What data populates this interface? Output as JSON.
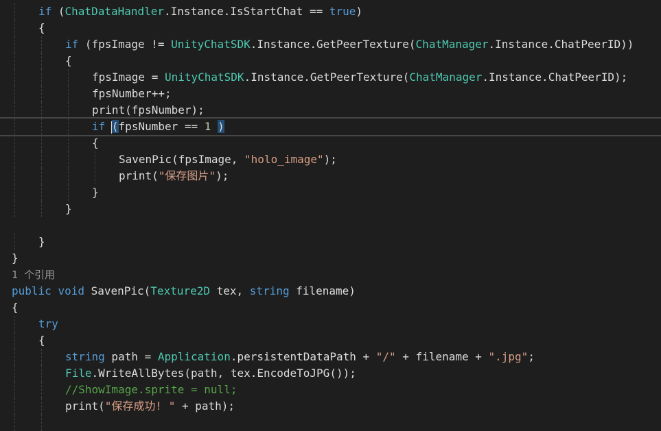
{
  "colors": {
    "background": "#1e1e1e",
    "keyword": "#569cd6",
    "type": "#4ec9b0",
    "string": "#d69d85",
    "comment": "#57a64a",
    "number": "#b5cea8",
    "plain": "#dcdcdc",
    "codelens": "#999999"
  },
  "editor": {
    "codelens": "1 个引用",
    "lines": [
      {
        "indent": 1,
        "tokens": [
          [
            "kw",
            "if"
          ],
          [
            "pl",
            " ("
          ],
          [
            "ty",
            "ChatDataHandler"
          ],
          [
            "pl",
            ".Instance.IsStartChat == "
          ],
          [
            "kw",
            "true"
          ],
          [
            "pl",
            ")"
          ]
        ]
      },
      {
        "indent": 1,
        "tokens": [
          [
            "pl",
            "{"
          ]
        ]
      },
      {
        "indent": 2,
        "tokens": [
          [
            "kw",
            "if"
          ],
          [
            "pl",
            " (fpsImage != "
          ],
          [
            "ty",
            "UnityChatSDK"
          ],
          [
            "pl",
            ".Instance.GetPeerTexture("
          ],
          [
            "ty",
            "ChatManager"
          ],
          [
            "pl",
            ".Instance.ChatPeerID))"
          ]
        ]
      },
      {
        "indent": 2,
        "tokens": [
          [
            "pl",
            "{"
          ]
        ]
      },
      {
        "indent": 3,
        "tokens": [
          [
            "pl",
            "fpsImage = "
          ],
          [
            "ty",
            "UnityChatSDK"
          ],
          [
            "pl",
            ".Instance.GetPeerTexture("
          ],
          [
            "ty",
            "ChatManager"
          ],
          [
            "pl",
            ".Instance.ChatPeerID);"
          ]
        ]
      },
      {
        "indent": 3,
        "tokens": [
          [
            "pl",
            "fpsNumber++;"
          ]
        ]
      },
      {
        "indent": 3,
        "tokens": [
          [
            "pl",
            "print(fpsNumber);"
          ]
        ]
      },
      {
        "indent": 3,
        "current": true,
        "tokens": [
          [
            "kw",
            "if"
          ],
          [
            "pl",
            " "
          ],
          [
            "hl",
            "("
          ],
          [
            "pl",
            "fpsNumber == "
          ],
          [
            "nu",
            "1"
          ],
          [
            "pl",
            " "
          ],
          [
            "hl",
            ")"
          ]
        ]
      },
      {
        "indent": 3,
        "tokens": [
          [
            "pl",
            "{"
          ]
        ]
      },
      {
        "indent": 4,
        "tokens": [
          [
            "pl",
            "SavenPic(fpsImage, "
          ],
          [
            "st",
            "\"holo_image\""
          ],
          [
            "pl",
            ");"
          ]
        ]
      },
      {
        "indent": 4,
        "tokens": [
          [
            "pl",
            "print("
          ],
          [
            "st",
            "\"保存图片\""
          ],
          [
            "pl",
            ");"
          ]
        ]
      },
      {
        "indent": 3,
        "tokens": [
          [
            "pl",
            "}"
          ]
        ]
      },
      {
        "indent": 2,
        "tokens": [
          [
            "pl",
            "}"
          ]
        ]
      },
      {
        "indent": 0,
        "tokens": []
      },
      {
        "indent": 1,
        "tokens": [
          [
            "pl",
            "}"
          ]
        ]
      },
      {
        "indent": 0,
        "tokens": [
          [
            "pl",
            "}"
          ]
        ]
      },
      {
        "indent": 0,
        "lens": true,
        "tokens": [
          [
            "lens",
            "1 个引用"
          ]
        ]
      },
      {
        "indent": 0,
        "tokens": [
          [
            "kw",
            "public"
          ],
          [
            "pl",
            " "
          ],
          [
            "kw",
            "void"
          ],
          [
            "pl",
            " SavenPic("
          ],
          [
            "ty",
            "Texture2D"
          ],
          [
            "pl",
            " tex, "
          ],
          [
            "kw",
            "string"
          ],
          [
            "pl",
            " filename)"
          ]
        ]
      },
      {
        "indent": 0,
        "tokens": [
          [
            "pl",
            "{"
          ]
        ]
      },
      {
        "indent": 1,
        "tokens": [
          [
            "kw",
            "try"
          ]
        ]
      },
      {
        "indent": 1,
        "tokens": [
          [
            "pl",
            "{"
          ]
        ]
      },
      {
        "indent": 2,
        "tokens": [
          [
            "kw",
            "string"
          ],
          [
            "pl",
            " path = "
          ],
          [
            "ty",
            "Application"
          ],
          [
            "pl",
            ".persistentDataPath + "
          ],
          [
            "st",
            "\"/\""
          ],
          [
            "pl",
            " + filename + "
          ],
          [
            "st",
            "\".jpg\""
          ],
          [
            "pl",
            ";"
          ]
        ]
      },
      {
        "indent": 2,
        "tokens": [
          [
            "ty",
            "File"
          ],
          [
            "pl",
            ".WriteAllBytes(path, tex.EncodeToJPG());"
          ]
        ]
      },
      {
        "indent": 2,
        "tokens": [
          [
            "cm",
            "//ShowImage.sprite = null;"
          ]
        ]
      },
      {
        "indent": 2,
        "tokens": [
          [
            "pl",
            "print("
          ],
          [
            "st",
            "\"保存成功! \""
          ],
          [
            "pl",
            " + path);"
          ]
        ]
      },
      {
        "indent": 2,
        "tokens": []
      }
    ]
  }
}
